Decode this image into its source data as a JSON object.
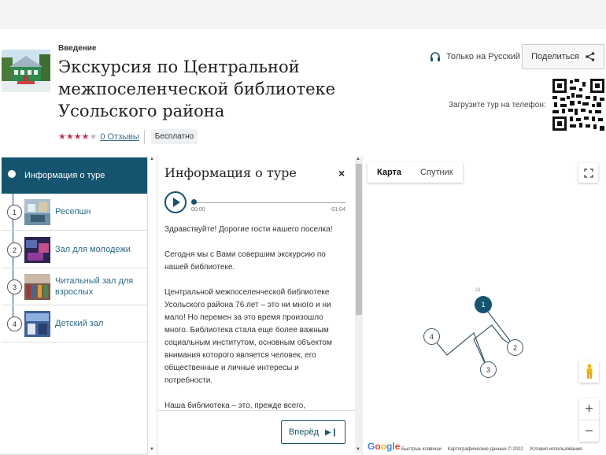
{
  "header": {
    "intro": "Введение",
    "title": "Экскурсия по Центральной межпоселенческой библиотеке Усольского района",
    "rating_stars": 4,
    "reviews_link": "0 Отзывы",
    "price_badge": "Бесплатно",
    "language_label": "Только на Русский",
    "share_label": "Поделиться",
    "download_label": "Загрузите тур на телефон:"
  },
  "sidebar": {
    "active_item": "Информация о туре",
    "stops": [
      {
        "num": "1",
        "label": "Ресепшн"
      },
      {
        "num": "2",
        "label": "Зал для молодежи"
      },
      {
        "num": "3",
        "label": "Читальный зал для взрослых"
      },
      {
        "num": "4",
        "label": "Детский зал"
      }
    ]
  },
  "panel": {
    "title": "Информация о туре",
    "close_glyph": "×",
    "time_elapsed": "00:00",
    "time_remaining": "-01:04",
    "paragraphs": [
      "Здравствуйте! Дорогие гости нашего поселка!",
      "Сегодня мы с Вами совершим экскурсию по нашей библиотеке.",
      "Центральной межпоселенческой библиотеке Усольского района 76 лет – это ни много и ни мало! Но перемен за это время произошло много. Библиотека стала еще более важным социальным институтом, основным объектом внимания которого является человек, его общественные и личные интересы и потребности.",
      "Наша библиотека – это, прежде всего,"
    ],
    "next_label": "Вперёд"
  },
  "map": {
    "type_map": "Карта",
    "type_satellite": "Спутник",
    "zoom_in": "+",
    "zoom_out": "−",
    "google_logo": "Google",
    "shortcuts": "Быстрые клавиши",
    "map_data": "Картографические данные © 2022",
    "terms": "Условия использования",
    "small_label": "21",
    "markers": [
      "1",
      "2",
      "3",
      "4"
    ]
  },
  "colors": {
    "accent": "#15546f",
    "star": "#c8334d",
    "link": "#3d6b8c"
  }
}
